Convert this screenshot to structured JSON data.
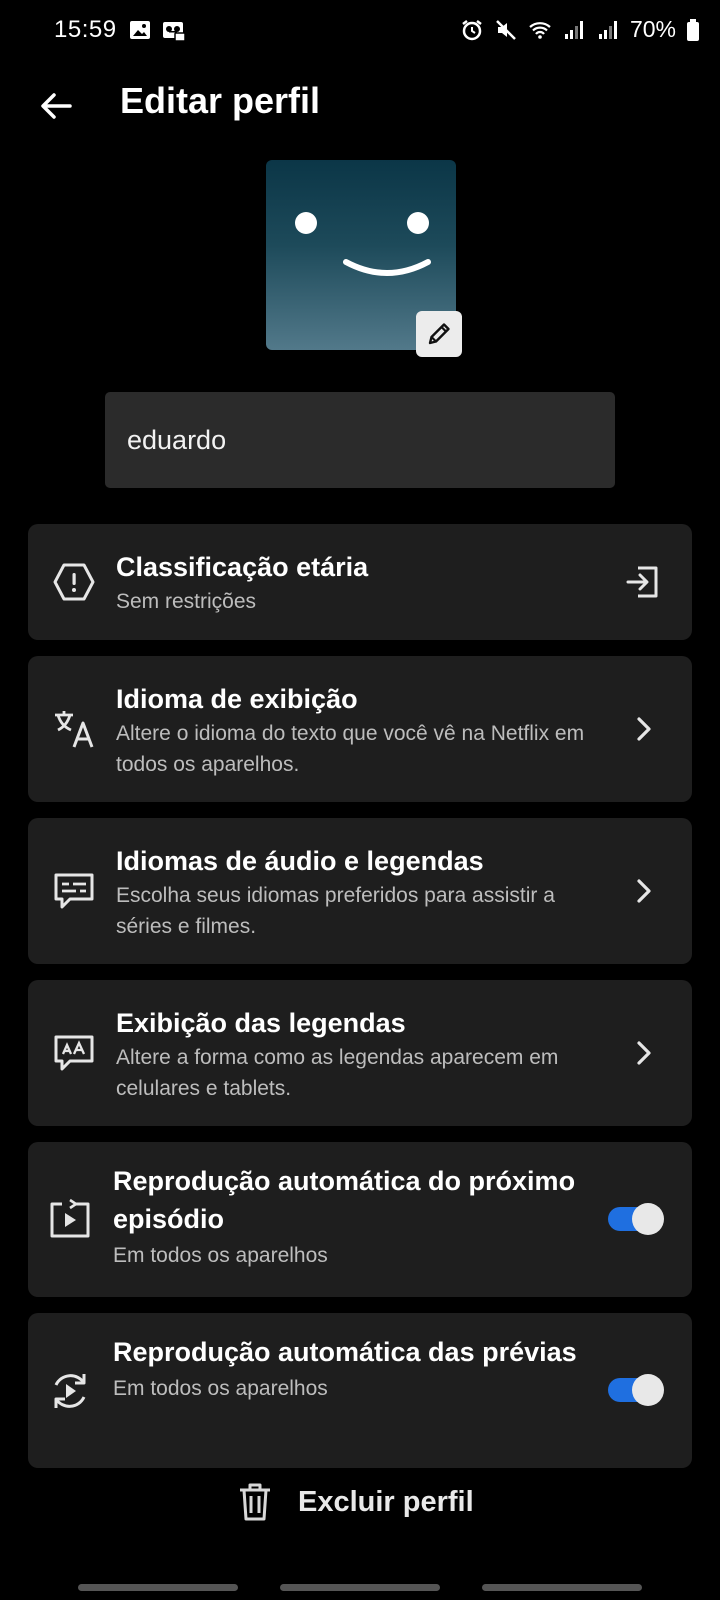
{
  "status_bar": {
    "time": "15:59",
    "left_icons": [
      "image-icon",
      "voicemail-icon"
    ],
    "right_icons": [
      "alarm-icon",
      "mute-icon",
      "wifi-icon",
      "signal-icon",
      "signal-icon",
      "battery-icon"
    ],
    "battery": "70%"
  },
  "header": {
    "title": "Editar perfil",
    "back_icon": "arrow-left-icon"
  },
  "profile": {
    "name": "eduardo",
    "avatar_edit_icon": "pencil-icon"
  },
  "settings": [
    {
      "title": "Classificação etária",
      "subtitle": "Sem restrições",
      "icon": "shield-exclaim-icon",
      "trailing": "open-external-icon"
    },
    {
      "title": "Idioma de exibição",
      "subtitle": "Altere o idioma do texto que você vê na Netflix em todos os aparelhos.",
      "icon": "translate-icon",
      "trailing": "chevron-right-icon"
    },
    {
      "title": "Idiomas de áudio e legendas",
      "subtitle": "Escolha seus idiomas preferidos para assistir a séries e filmes.",
      "icon": "subtitles-icon",
      "trailing": "chevron-right-icon"
    },
    {
      "title": "Exibição das legendas",
      "subtitle": "Altere a forma como as legendas aparecem em celulares e tablets.",
      "icon": "caption-style-icon",
      "trailing": "chevron-right-icon"
    },
    {
      "title": "Reprodução automática do próximo episódio",
      "subtitle": "Em todos os aparelhos",
      "icon": "next-episode-icon",
      "trailing": "toggle",
      "enabled": true
    },
    {
      "title": "Reprodução automática das prévias",
      "subtitle": "Em todos os aparelhos",
      "icon": "previews-icon",
      "trailing": "toggle",
      "enabled": true
    }
  ],
  "footer": {
    "delete_label": "Excluir perfil",
    "delete_icon": "trash-icon"
  },
  "colors": {
    "background": "#000000",
    "card": "#1e1e1e",
    "toggle_on": "#1f6fe0",
    "subtext": "#bdbdbd"
  }
}
